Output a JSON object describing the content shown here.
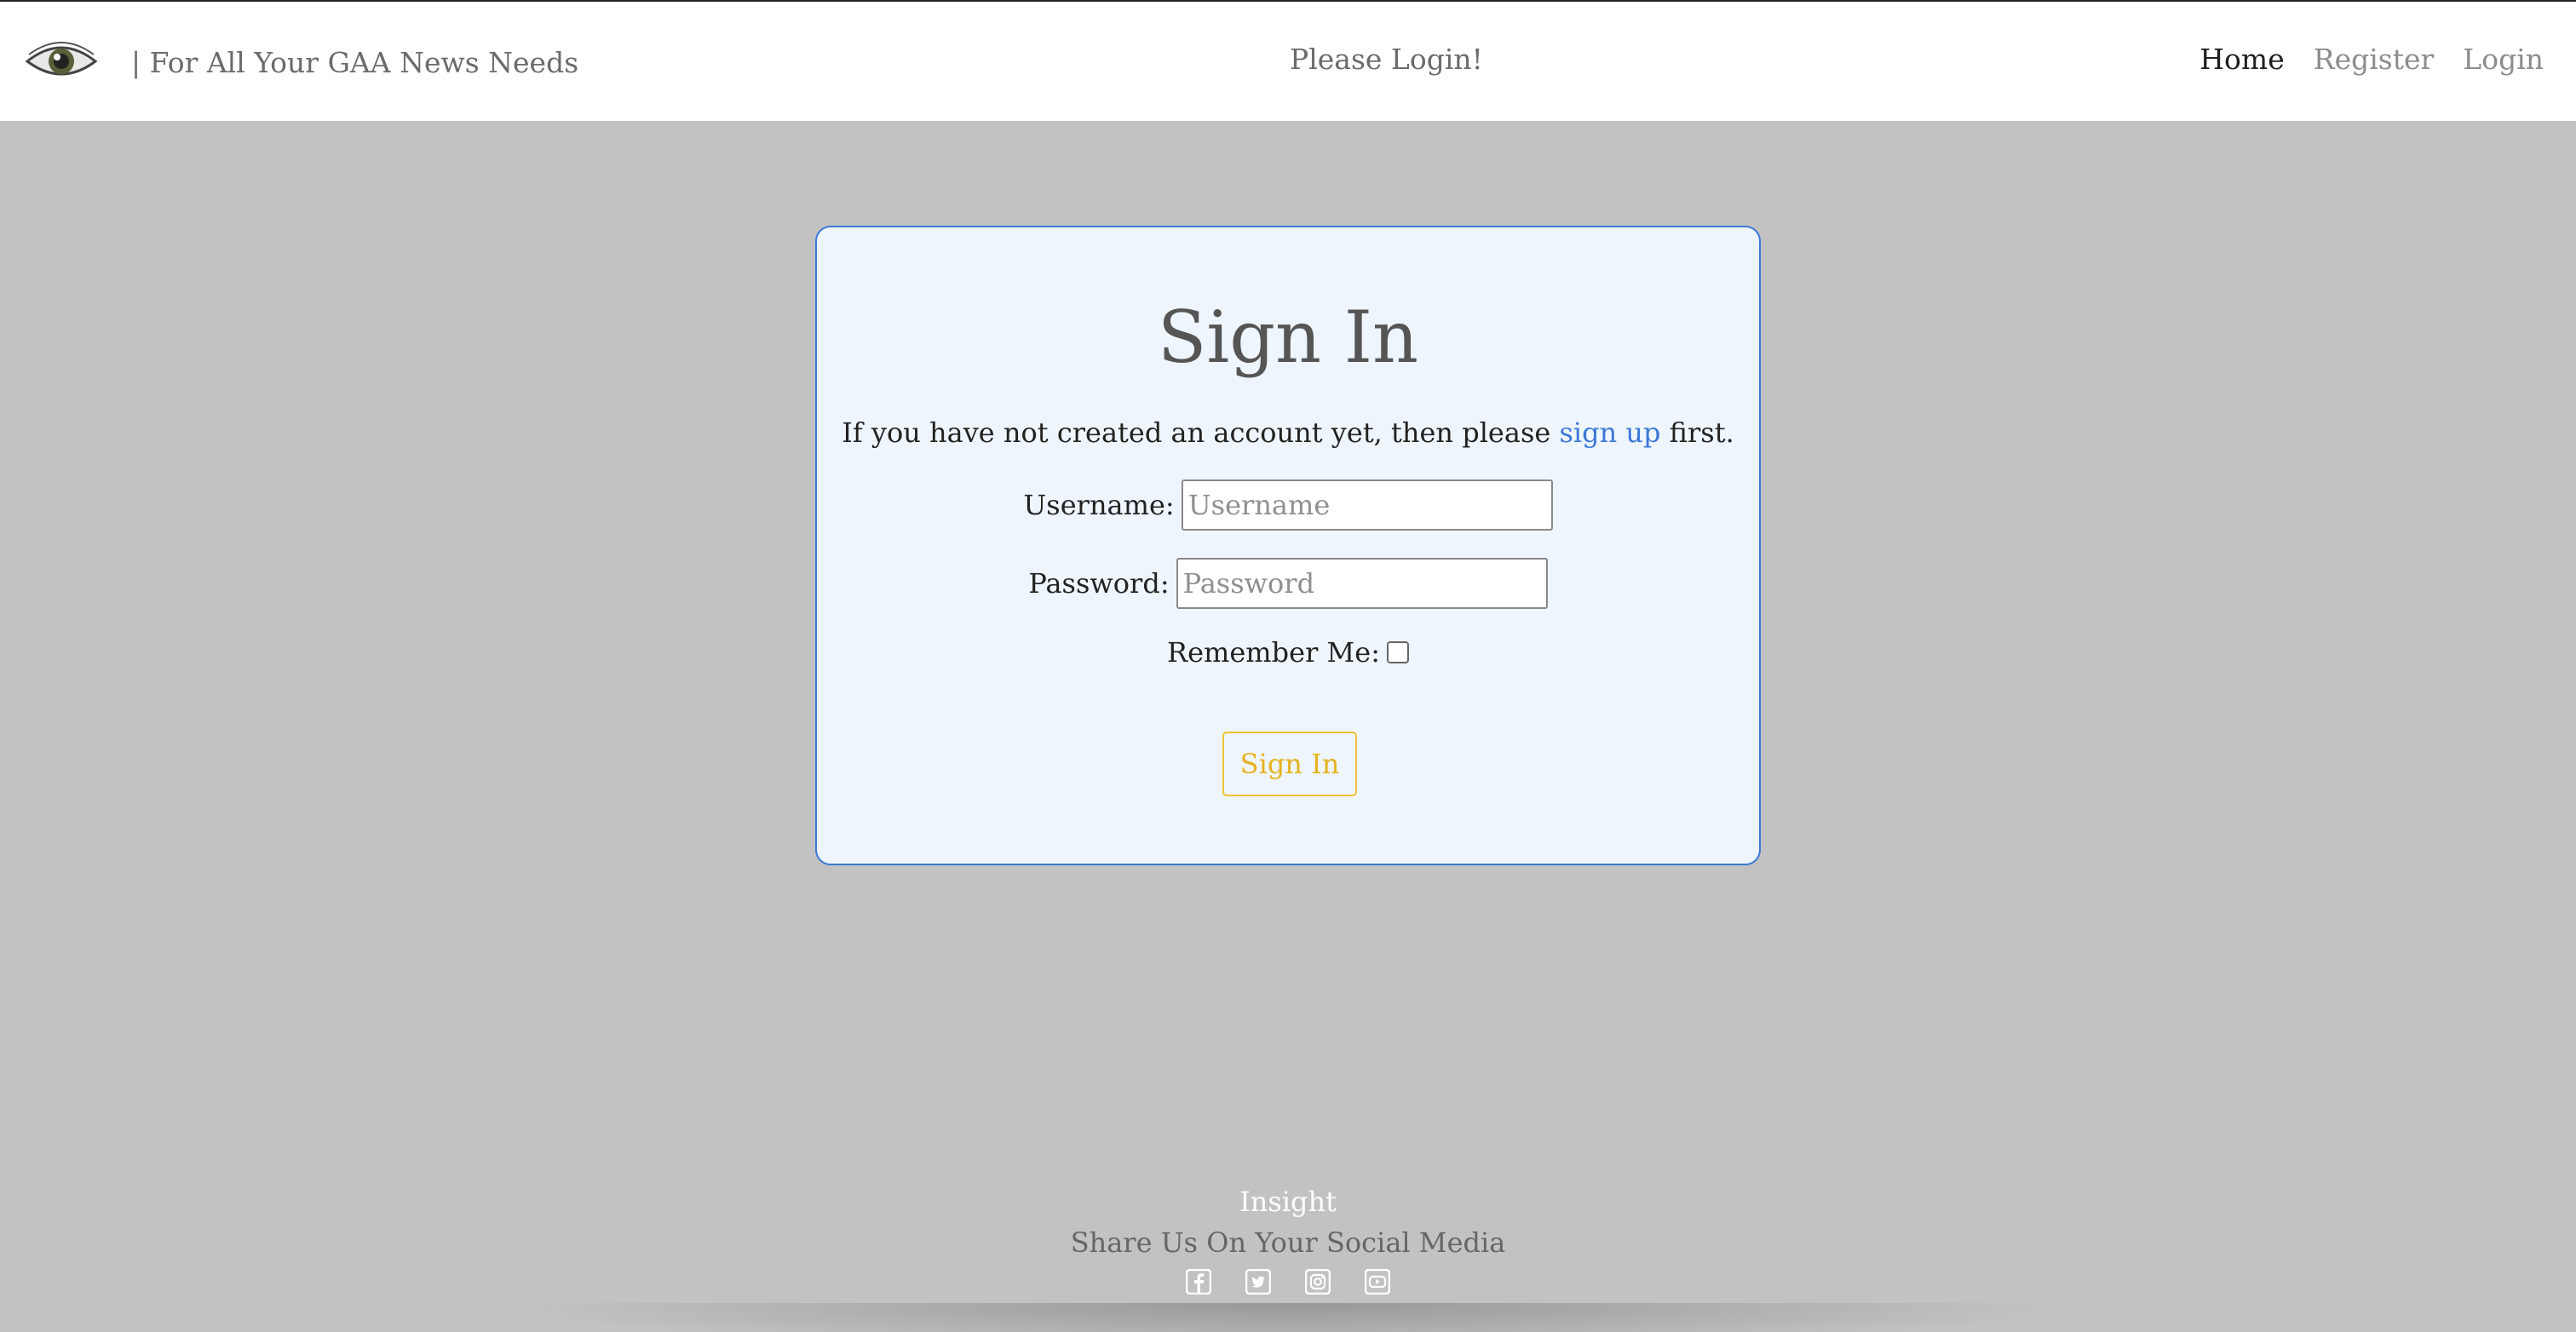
{
  "header": {
    "tagline": "| For All Your GAA News Needs",
    "notice": "Please Login!",
    "nav": [
      {
        "label": "Home",
        "active": true
      },
      {
        "label": "Register",
        "active": false
      },
      {
        "label": "Login",
        "active": false
      }
    ]
  },
  "signin": {
    "title": "Sign In",
    "intro_before": "If you have not created an account yet, then please ",
    "intro_link": "sign up",
    "intro_after": " first.",
    "username_label": "Username:",
    "username_placeholder": "Username",
    "username_value": "",
    "password_label": "Password:",
    "password_placeholder": "Password",
    "password_value": "",
    "remember_label": "Remember Me:",
    "remember_checked": false,
    "submit_label": "Sign In"
  },
  "footer": {
    "brand": "Insight",
    "share_text": "Share Us On Your Social Media",
    "socials": [
      "facebook-icon",
      "twitter-icon",
      "instagram-icon",
      "youtube-icon"
    ]
  },
  "colors": {
    "page_bg": "#c2c2c2",
    "card_bg": "#eff5fc",
    "card_border": "#3b78d8",
    "link": "#3b78d8",
    "button_accent": "#f0c23a"
  }
}
